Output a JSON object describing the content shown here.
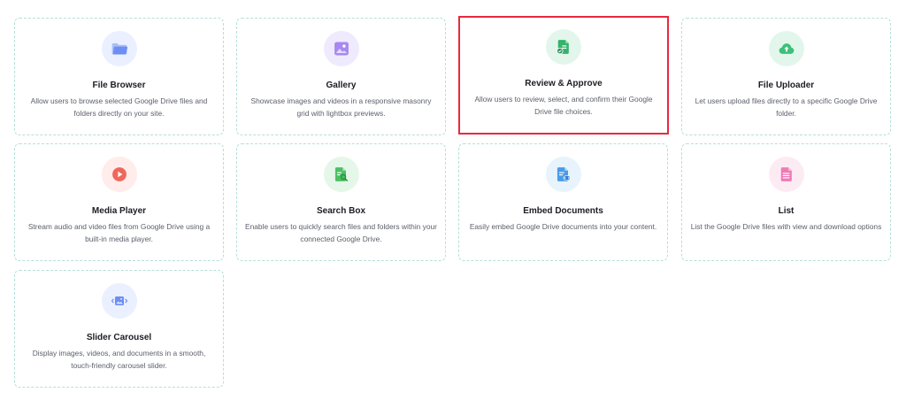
{
  "modules": [
    {
      "id": "file-browser",
      "title": "File Browser",
      "description": "Allow users to browse selected Google Drive files and folders directly on your site.",
      "icon": "folder-icon",
      "icon_bg": "#eaf0ff",
      "icon_color": "#6d8ef2",
      "selected": false
    },
    {
      "id": "gallery",
      "title": "Gallery",
      "description": "Showcase images and videos in a responsive masonry grid with lightbox previews.",
      "icon": "image-icon",
      "icon_bg": "#efeafe",
      "icon_color": "#a789f0",
      "selected": false
    },
    {
      "id": "review-approve",
      "title": "Review & Approve",
      "description": "Allow users to review, select, and confirm their Google Drive file choices.",
      "icon": "document-check-icon",
      "icon_bg": "#e3f6ec",
      "icon_color": "#34b36a",
      "selected": true
    },
    {
      "id": "file-uploader",
      "title": "File Uploader",
      "description": "Let users upload files directly to a specific Google Drive folder.",
      "icon": "cloud-upload-icon",
      "icon_bg": "#e3f6ec",
      "icon_color": "#3cc07a",
      "selected": false
    },
    {
      "id": "media-player",
      "title": "Media Player",
      "description": "Stream audio and video files from Google Drive using a built-in media player.",
      "icon": "play-icon",
      "icon_bg": "#ffeceb",
      "icon_color": "#f0665a",
      "selected": false
    },
    {
      "id": "search-box",
      "title": "Search Box",
      "description": "Enable users to quickly search files and folders within your connected Google Drive.",
      "icon": "search-document-icon",
      "icon_bg": "#e5f7e9",
      "icon_color": "#4cc064",
      "selected": false
    },
    {
      "id": "embed-documents",
      "title": "Embed Documents",
      "description": "Easily embed Google Drive documents into your content.",
      "icon": "embed-document-icon",
      "icon_bg": "#e7f3fd",
      "icon_color": "#4a9be8",
      "selected": false
    },
    {
      "id": "list",
      "title": "List",
      "description": "List the Google Drive files with view and download options",
      "icon": "list-document-icon",
      "icon_bg": "#fdebf4",
      "icon_color": "#f07ab5",
      "selected": false
    },
    {
      "id": "slider-carousel",
      "title": "Slider Carousel",
      "description": "Display images, videos, and documents in a smooth, touch-friendly carousel slider.",
      "icon": "carousel-icon",
      "icon_bg": "#eaf0ff",
      "icon_color": "#6d8ef2",
      "selected": false
    }
  ]
}
